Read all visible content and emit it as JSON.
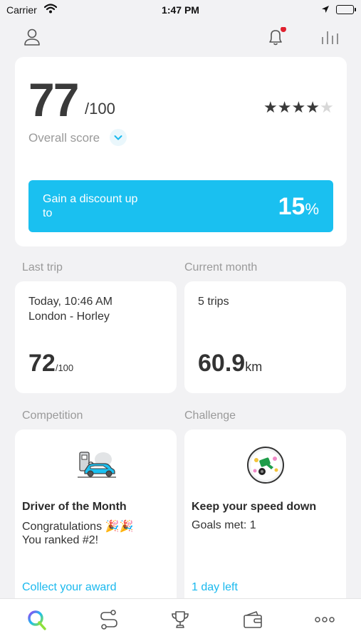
{
  "status_bar": {
    "carrier": "Carrier",
    "time": "1:47 PM"
  },
  "top_bar": {
    "icons": [
      "profile-icon",
      "notification-bell-icon",
      "stats-chart-icon"
    ],
    "has_unread_notification": true
  },
  "score": {
    "value": "77",
    "out_of": "/100",
    "label": "Overall score",
    "stars": {
      "filled": 4,
      "total": 5
    }
  },
  "discount": {
    "label": "Gain a discount up to",
    "value": "15",
    "unit": "%"
  },
  "last_trip": {
    "section_label": "Last trip",
    "date": "Today, 10:46 AM",
    "route": "London - Horley",
    "score": "72",
    "score_unit": "/100"
  },
  "current_month": {
    "section_label": "Current month",
    "trips": "5 trips",
    "distance": "60.9",
    "distance_unit": "km"
  },
  "competition": {
    "section_label": "Competition",
    "title": "Driver of the Month",
    "line1": "Congratulations 🎉🎉",
    "line2": "You ranked #2!",
    "link": "Collect your award"
  },
  "challenge": {
    "section_label": "Challenge",
    "title": "Keep your speed down",
    "line1": "Goals met: 1",
    "link": "1 day left"
  },
  "tab_bar": {
    "tabs": [
      "home-tab",
      "trips-tab",
      "competitions-tab",
      "wallet-tab",
      "more-tab"
    ],
    "active": "home-tab"
  },
  "colors": {
    "accent": "#1AC0F0",
    "badge": "#E0202E"
  }
}
